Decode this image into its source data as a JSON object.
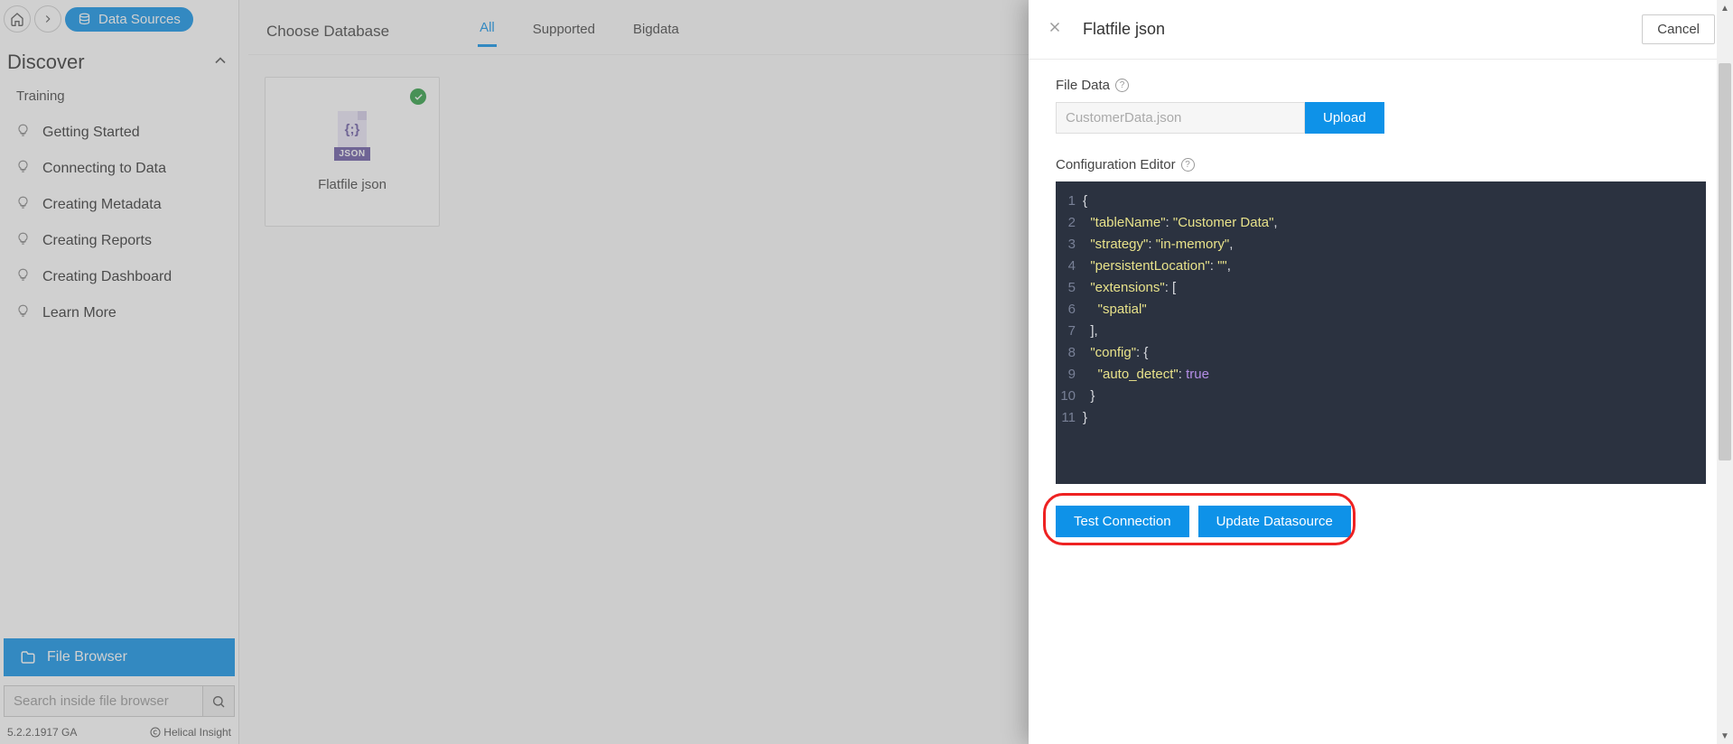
{
  "breadcrumb": {
    "page_label": "Data Sources"
  },
  "sidebar": {
    "discover": "Discover",
    "group": "Training",
    "items": [
      {
        "label": "Getting Started"
      },
      {
        "label": "Connecting to Data"
      },
      {
        "label": "Creating Metadata"
      },
      {
        "label": "Creating Reports"
      },
      {
        "label": "Creating Dashboard"
      },
      {
        "label": "Learn More"
      }
    ],
    "file_browser": "File Browser",
    "search_placeholder": "Search inside file browser",
    "version": "5.2.2.1917 GA",
    "powered": "Helical Insight"
  },
  "main": {
    "choose_database": "Choose Database",
    "tabs": [
      {
        "label": "All",
        "active": true
      },
      {
        "label": "Supported",
        "active": false
      },
      {
        "label": "Bigdata",
        "active": false
      }
    ],
    "card_label": "Flatfile json",
    "json_tag": "JSON",
    "json_brace": "{;}"
  },
  "panel": {
    "title": "Flatfile json",
    "cancel": "Cancel",
    "file_data_label": "File Data",
    "file_placeholder": "CustomerData.json",
    "upload": "Upload",
    "config_editor_label": "Configuration Editor",
    "test_connection": "Test Connection",
    "update_datasource": "Update Datasource",
    "editor_lines": [
      {
        "n": "1",
        "html": "<span class='tok-brace'>{</span>"
      },
      {
        "n": "2",
        "html": "  <span class='tok-key'>\"tableName\"</span><span class='tok-punc'>: </span><span class='tok-key'>\"Customer Data\"</span><span class='tok-punc'>,</span>"
      },
      {
        "n": "3",
        "html": "  <span class='tok-key'>\"strategy\"</span><span class='tok-punc'>: </span><span class='tok-key'>\"in-memory\"</span><span class='tok-punc'>,</span>"
      },
      {
        "n": "4",
        "html": "  <span class='tok-key'>\"persistentLocation\"</span><span class='tok-punc'>: </span><span class='tok-key'>\"\"</span><span class='tok-punc'>,</span>"
      },
      {
        "n": "5",
        "html": "  <span class='tok-key'>\"extensions\"</span><span class='tok-punc'>: [</span>"
      },
      {
        "n": "6",
        "html": "    <span class='tok-key'>\"spatial\"</span>"
      },
      {
        "n": "7",
        "html": "  <span class='tok-punc'>],</span>"
      },
      {
        "n": "8",
        "html": "  <span class='tok-key'>\"config\"</span><span class='tok-punc'>: {</span>"
      },
      {
        "n": "9",
        "html": "    <span class='tok-key'>\"auto_detect\"</span><span class='tok-punc'>: </span><span class='tok-bool'>true</span>"
      },
      {
        "n": "10",
        "html": "  <span class='tok-brace'>}</span>"
      },
      {
        "n": "11",
        "html": "<span class='tok-brace'>}</span>"
      }
    ]
  }
}
